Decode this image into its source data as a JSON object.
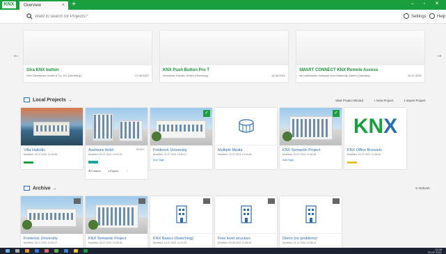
{
  "app": {
    "logo": "KNX",
    "tab_label": "Overview",
    "tab_close": "×",
    "tab_add": "+",
    "window_controls": "– ▫ ✕"
  },
  "toolbar": {
    "search_placeholder": "Want to search for Projects?",
    "settings_label": "Settings",
    "help_label": "Help"
  },
  "carousel": {
    "prev": "←",
    "next": "→",
    "items": [
      {
        "title": "Gira KNX button",
        "sub": "Gira Giersiepen GmbH & Co. KG (Germany)",
        "date": "17.08.2021"
      },
      {
        "title": "KNX Push Button Pro T",
        "sub": "Schneider Electric GmbH (Germany)",
        "date": "14.08.2021"
      },
      {
        "title": "SMART CONNECT KNX Remote Access",
        "sub": "ise Individuelle Software und Elektronik GmbH (Germany)",
        "date": "16.07.2021"
      }
    ]
  },
  "local": {
    "title": "Local Projects →",
    "actions": [
      "Start Project Wizard",
      "+ New Project",
      "⭳ Import Project"
    ],
    "projects": [
      {
        "title": "Villa Halloltic",
        "modified": "Modified: 20.07.2021 14:05:48",
        "bar_color": "#1b9e3e"
      },
      {
        "title": "Aventura Hotel",
        "modified": "Modified: 20.07.2021 14:02:28",
        "bar_color": "#1ca3a6",
        "badge": "READY",
        "row": [
          "⏲ Folders",
          "⭳ Export",
          "⋮"
        ]
      },
      {
        "title": "Frederick University",
        "modified": "Modified: 20.07.2021 13:39:17",
        "tag": "Add Tags",
        "check": "✓"
      },
      {
        "title": "Multiple Media",
        "modified": "Modified: 20.07.2021 13:48:48"
      },
      {
        "title": "KNX Semantic Project",
        "modified": "Modified: 20.07.2021 11:38:38",
        "tag": "Add Tags",
        "check": "✓"
      },
      {
        "title": "KNX Office Brussels",
        "modified": "Modified: 20.07.2021 11:39:40",
        "bar_color": "#e6c229",
        "logo_left": "KN",
        "logo_right": "X"
      }
    ]
  },
  "archive": {
    "title": "Archive →",
    "refresh": "↻ Refresh",
    "projects": [
      {
        "title": "Frederick University",
        "modified": "Modified: 20.07.2021 13:39:17"
      },
      {
        "title": "KNX Semantic Project",
        "modified": "Modified: 20.07.2021 13:36:38"
      },
      {
        "title": "KNX Basics (Switching)",
        "modified": "Modified: 14.07.2021 11:22:05"
      },
      {
        "title": "Free level structure",
        "modified": "Modified: 08.06.2021 11:08:40"
      },
      {
        "title": "Demo (no problems)",
        "modified": "Modified: 01.07.2021 12:08:41"
      }
    ]
  },
  "taskbar": {
    "time": "11:08",
    "date": "20.07.2021"
  }
}
